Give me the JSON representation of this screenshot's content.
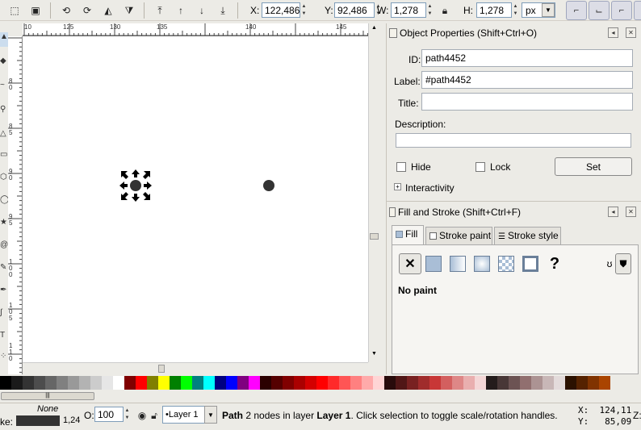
{
  "toolbar": {
    "x_label": "X:",
    "x_value": "122,486",
    "y_label": "Y:",
    "y_value": "92,486",
    "w_label": "W:",
    "w_value": "1,278",
    "h_label": "H:",
    "h_value": "1,278",
    "unit": "px"
  },
  "ruler": {
    "h_ticks": [
      "10",
      "125",
      "130",
      "135",
      "140",
      "145"
    ],
    "v_ticks": [
      "80",
      "85",
      "90",
      "95",
      "100",
      "105",
      "110"
    ]
  },
  "object_properties": {
    "title": "Object Properties (Shift+Ctrl+O)",
    "id_label": "ID:",
    "id_value": "path4452",
    "label_label": "Label:",
    "label_value": "#path4452",
    "title_label": "Title:",
    "title_value": "",
    "description_label": "Description:",
    "description_value": "",
    "hide_label": "Hide",
    "lock_label": "Lock",
    "set_label": "Set",
    "interactivity_label": "Interactivity"
  },
  "fill_stroke": {
    "title": "Fill and Stroke (Shift+Ctrl+F)",
    "tabs": [
      "Fill",
      "Stroke paint",
      "Stroke style"
    ],
    "status": "No paint"
  },
  "palette": {
    "colors": [
      "#000000",
      "#1a1a1a",
      "#333333",
      "#4d4d4d",
      "#666666",
      "#808080",
      "#999999",
      "#b3b3b3",
      "#cccccc",
      "#e6e6e6",
      "#ffffff",
      "#800000",
      "#ff0000",
      "#808000",
      "#ffff00",
      "#008000",
      "#00ff00",
      "#008080",
      "#00ffff",
      "#000080",
      "#0000ff",
      "#800080",
      "#ff00ff",
      "#2b0000",
      "#550000",
      "#800000",
      "#aa0000",
      "#d40000",
      "#ff0000",
      "#ff2a2a",
      "#ff5555",
      "#ff8080",
      "#ffaaaa",
      "#ffd5d5",
      "#280b0b",
      "#501616",
      "#782121",
      "#a02c2c",
      "#c83737",
      "#d35f5f",
      "#de8787",
      "#e9afaf",
      "#f4d7d7",
      "#241c1c",
      "#483737",
      "#6c5353",
      "#916f6f",
      "#ac9393",
      "#c8b7b7",
      "#e3dbdb",
      "#2b1100",
      "#552200",
      "#803300",
      "#aa4400"
    ]
  },
  "status_bar": {
    "stroke_label": "ke:",
    "fill_none": "None",
    "stroke_width": "1,24",
    "opacity_label": "O:",
    "opacity_value": "100",
    "layer_name": "•Layer 1",
    "message_bold": "Path",
    "message_1": " 2 nodes in layer ",
    "message_layer": "Layer 1",
    "message_2": ". Click selection to toggle scale/rotation handles.",
    "coord_x": "X:  124,11",
    "coord_y": "Y:   85,09",
    "zoom_label": "Z:"
  }
}
